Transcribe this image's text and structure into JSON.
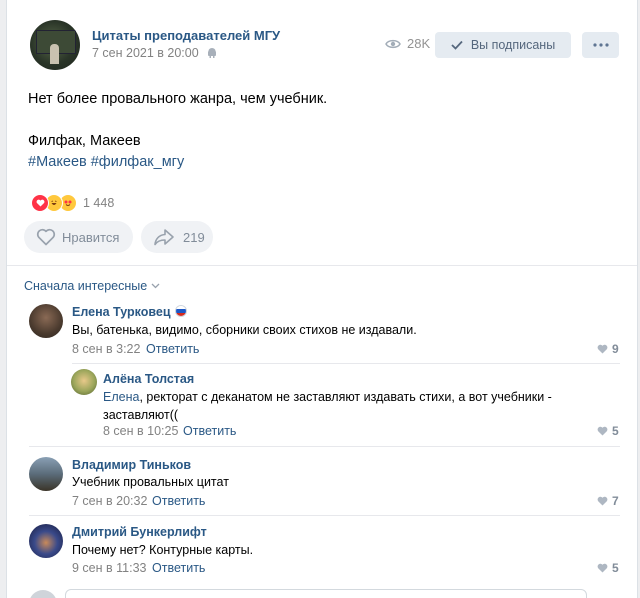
{
  "post": {
    "group_name": "Цитаты преподавателей МГУ",
    "date": "7 сен 2021 в 20:00",
    "views": "28K",
    "subscribed_label": "Вы подписаны",
    "text_line1": "Нет более провального жанра, чем учебник.",
    "text_line2": "Филфак, Макеев",
    "hashtags": "#Макеев #филфак_мгу",
    "reactions_count": "1 448",
    "like_label": "Нравится",
    "share_count": "219"
  },
  "comments_section": {
    "sort_label": "Сначала интересные"
  },
  "comments": [
    {
      "name": "Елена Турковец",
      "text": "Вы, батенька, видимо, сборники своих стихов не издавали.",
      "date": "8 сен в 3:22",
      "reply_label": "Ответить",
      "likes": "9"
    },
    {
      "name": "Алёна Толстая",
      "mention": "Елена",
      "text_rest": ", ректорат с деканатом не заставляют издавать стихи, а вот учебники -",
      "text_line2": "заставляют((",
      "date": "8 сен в 10:25",
      "reply_label": "Ответить",
      "likes": "5"
    },
    {
      "name": "Владимир Тиньков",
      "text": "Учебник провальных цитат",
      "date": "7 сен в 20:32",
      "reply_label": "Ответить",
      "likes": "7"
    },
    {
      "name": "Дмитрий Бункерлифт",
      "text": "Почему нет? Контурные карты.",
      "date": "9 сен в 11:33",
      "reply_label": "Ответить",
      "likes": "5"
    }
  ],
  "colors": {
    "link": "#2a5885",
    "muted": "#828282",
    "button_bg": "#e5ebf1",
    "page_bg": "#edeef0"
  },
  "icons": [
    "android-icon",
    "eye-icon",
    "check-icon",
    "more-dots-icon",
    "heart-icon",
    "share-icon",
    "chevron-down-icon",
    "russia-flag-icon"
  ]
}
